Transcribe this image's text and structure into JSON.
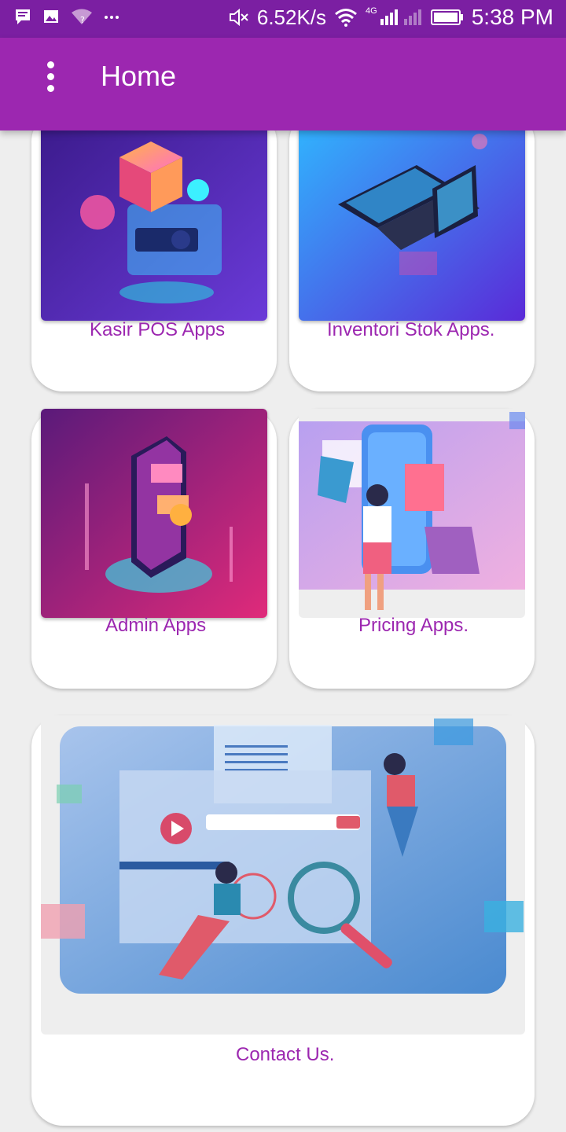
{
  "status_bar": {
    "net_speed": "6.52K/s",
    "net_type": "4G",
    "time": "5:38 PM",
    "icons": [
      "message-icon",
      "image-icon",
      "wifi-question-icon",
      "more-dots-icon",
      "mute-icon",
      "wifi-icon",
      "signal-icon",
      "battery-icon"
    ]
  },
  "app_bar": {
    "title": "Home",
    "menu_icon": "more-vertical-icon",
    "color": "#9c27b0"
  },
  "menu": [
    {
      "label": "Kasir POS Apps"
    },
    {
      "label": "Inventori Stok Apps."
    },
    {
      "label": "Admin Apps"
    },
    {
      "label": "Pricing Apps."
    },
    {
      "label": "Contact Us."
    }
  ],
  "colors": {
    "accent": "#9c27b0",
    "status_bar": "#7b1fa2",
    "background": "#eeeeee"
  }
}
